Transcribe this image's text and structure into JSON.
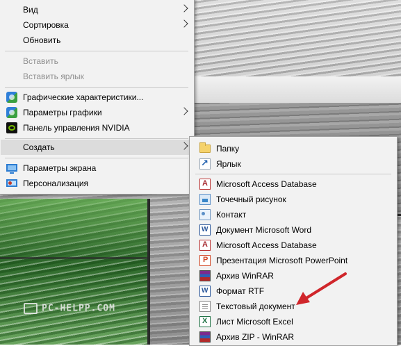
{
  "watermark": "PC-HELPP.COM",
  "main_menu": {
    "view": "Вид",
    "sort": "Сортировка",
    "refresh": "Обновить",
    "paste": "Вставить",
    "paste_shortcut": "Вставить ярлык",
    "graphics_props": "Графические характеристики...",
    "graphics_options": "Параметры графики",
    "nvidia_panel": "Панель управления NVIDIA",
    "create": "Создать",
    "display_settings": "Параметры экрана",
    "personalize": "Персонализация"
  },
  "submenu": {
    "folder": "Папку",
    "shortcut": "Ярлык",
    "access1": "Microsoft Access Database",
    "bitmap": "Точечный рисунок",
    "contact": "Контакт",
    "word": "Документ Microsoft Word",
    "access2": "Microsoft Access Database",
    "ppt": "Презентация Microsoft PowerPoint",
    "winrar": "Архив WinRAR",
    "rtf": "Формат RTF",
    "text": "Текстовый документ",
    "excel": "Лист Microsoft Excel",
    "zip": "Архив ZIP - WinRAR"
  },
  "colors": {
    "menu_bg": "#f2f2f2",
    "highlight": "#dcdcdc",
    "disabled_text": "#8f8f8f",
    "arrow": "#d0262b"
  }
}
